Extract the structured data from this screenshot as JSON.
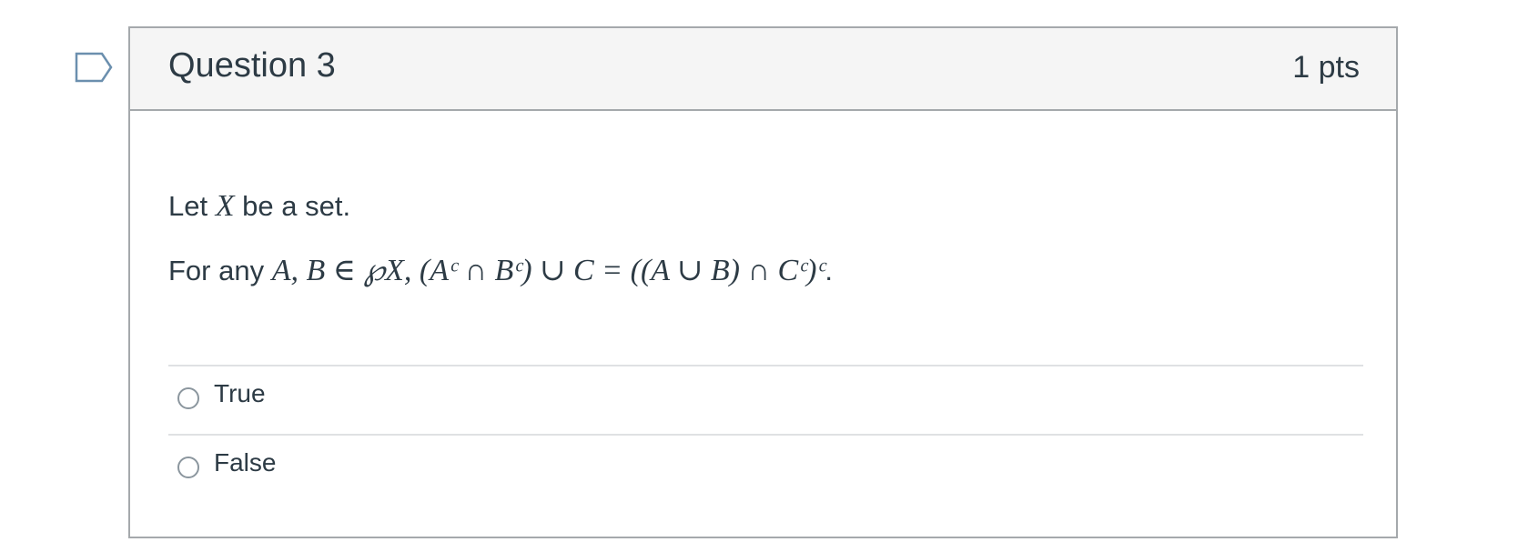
{
  "question": {
    "title": "Question 3",
    "points": "1 pts",
    "body": {
      "line1_prefix": "Let",
      "line1_var": "X",
      "line1_suffix": "be a set.",
      "line2_prefix": "For any",
      "line2_math": "A, B ∈ ℘X, (Aᶜ ∩ Bᶜ) ∪ C = ((A ∪ B) ∩ Cᶜ)ᶜ",
      "line2_suffix": "."
    },
    "answers": [
      {
        "label": "True",
        "selected": false
      },
      {
        "label": "False",
        "selected": false
      }
    ]
  },
  "icons": {
    "flag": "flag-question-icon",
    "radio": "radio-unchecked-icon"
  },
  "colors": {
    "text": "#2d3b45",
    "border": "#a5a9ac",
    "header_bg": "#f5f5f5",
    "divider": "#dfe1e3",
    "flag_stroke": "#6b8fae",
    "radio_stroke": "#8b969e"
  }
}
